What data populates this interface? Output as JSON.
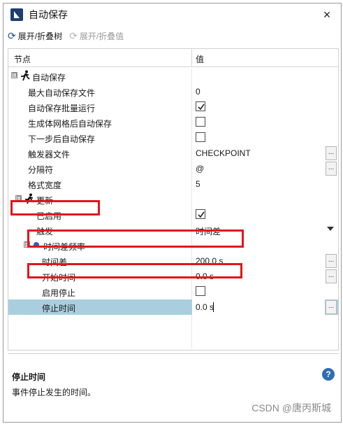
{
  "window": {
    "title": "自动保存",
    "close_glyph": "×"
  },
  "toolbar": {
    "expand_collapse_tree": "展开/折叠树",
    "expand_collapse_values": "展开/折叠值"
  },
  "grid": {
    "col_node": "节点",
    "col_value": "值",
    "rows": {
      "autosave": {
        "name": "自动保存",
        "expander": "⊟"
      },
      "max_files": {
        "name": "最大自动保存文件",
        "value": "0"
      },
      "batch_run": {
        "name": "自动保存批量运行",
        "checked": true
      },
      "gen_mesh": {
        "name": "生成体网格后自动保存",
        "checked": false
      },
      "next_step": {
        "name": "下一步后自动保存",
        "checked": false
      },
      "trigger_file": {
        "name": "触发器文件",
        "value": "CHECKPOINT",
        "button": "..."
      },
      "separator": {
        "name": "分隔符",
        "value": "@",
        "button": "..."
      },
      "format_width": {
        "name": "格式宽度",
        "value": "5"
      },
      "update": {
        "name": "更新",
        "expander": "⊟"
      },
      "enabled": {
        "name": "已启用",
        "checked": true
      },
      "trigger": {
        "name": "触发",
        "value": "时间差"
      },
      "time_freq": {
        "name": "时间差频率",
        "expander": "⊟"
      },
      "time_delta": {
        "name": "时间差",
        "value": "200.0 s",
        "button": "..."
      },
      "start_time": {
        "name": "开始时间",
        "value": "0.0 s",
        "button": "..."
      },
      "enable_stop": {
        "name": "启用停止",
        "checked": false
      },
      "stop_time": {
        "name": "停止时间",
        "value": "0.0 s",
        "button": "..."
      }
    }
  },
  "description": {
    "title": "停止时间",
    "text": "事件停止发生的时间。",
    "help_glyph": "?"
  },
  "watermark": "CSDN @唐丙斯城",
  "colors": {
    "highlight_box": "#e0171c",
    "selected_row": "#a9cfdf",
    "accent": "#1f3e6e"
  }
}
